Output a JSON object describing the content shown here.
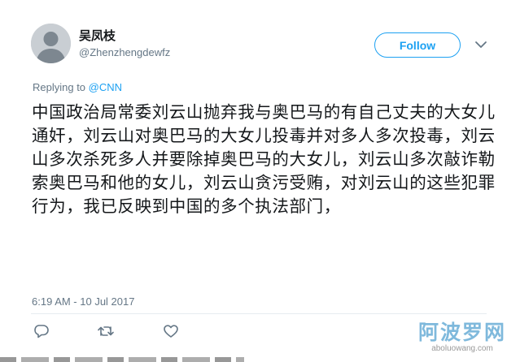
{
  "tweet": {
    "author": {
      "display_name": "吴凤枝",
      "handle": "@Zhenzhengdewfz"
    },
    "follow_label": "Follow",
    "replying_prefix": "Replying to",
    "replying_to": "@CNN",
    "text": "中国政治局常委刘云山抛弃我与奥巴马的有自己丈夫的大女儿通奸，刘云山对奥巴马的大女儿投毒并对多人多次投毒，刘云山多次杀死多人并要除掉奥巴马的大女儿，刘云山多次敲诈勒索奥巴马和他的女儿，刘云山贪污受贿，对刘云山的这些犯罪行为，我已反映到中国的多个执法部门，",
    "timestamp": "6:19 AM - 10 Jul 2017"
  },
  "actions": [
    "reply-icon",
    "retweet-icon",
    "like-icon"
  ],
  "watermark": {
    "name": "阿波罗网",
    "url": "aboluowang.com"
  },
  "colors": {
    "accent": "#1da1f2",
    "secondary_text": "#657786",
    "primary_text": "#14171a",
    "divider": "#e6ecf0"
  }
}
